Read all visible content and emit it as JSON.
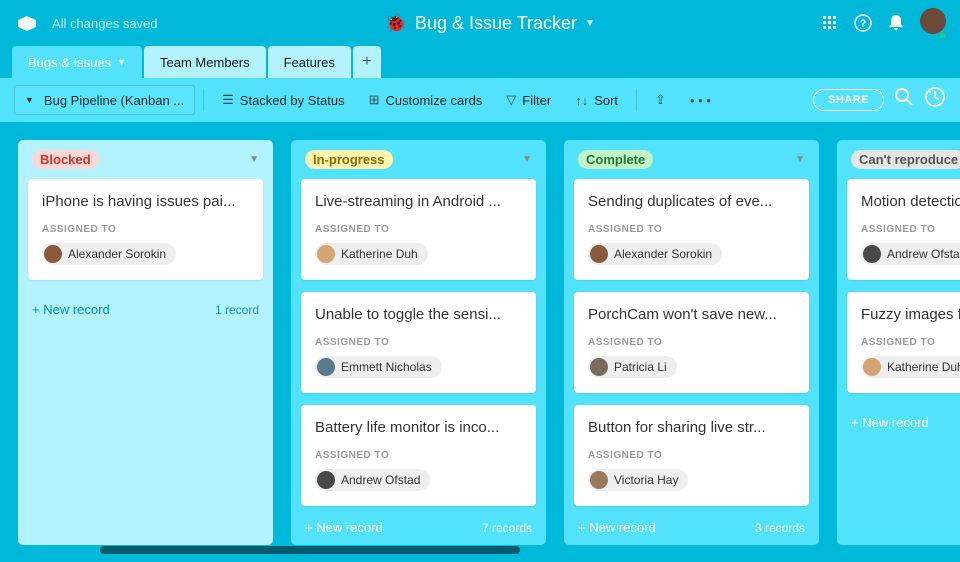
{
  "header": {
    "saved_status": "All changes saved",
    "title": "Bug & Issue Tracker"
  },
  "tabs": [
    {
      "label": "Bugs & Issues",
      "active": true,
      "has_caret": true
    },
    {
      "label": "Team Members",
      "active": false
    },
    {
      "label": "Features",
      "active": false
    }
  ],
  "toolbar": {
    "view_name": "Bug Pipeline (Kanban ...",
    "stacked": "Stacked by Status",
    "customize": "Customize cards",
    "filter": "Filter",
    "sort": "Sort",
    "share": "SHARE"
  },
  "columns": [
    {
      "title": "Blocked",
      "title_class": "title-blocked",
      "light": true,
      "record_count": "1 record",
      "new_record": "+ New record",
      "cards": [
        {
          "title": "iPhone is having issues pai...",
          "assigned_label": "ASSIGNED TO",
          "assignee": "Alexander Sorokin",
          "av": "c1"
        }
      ]
    },
    {
      "title": "In-progress",
      "title_class": "title-inprog",
      "light": false,
      "record_count": "7 records",
      "new_record": "+ New record",
      "cards": [
        {
          "title": "Live-streaming in Android ...",
          "assigned_label": "ASSIGNED TO",
          "assignee": "Katherine Duh",
          "av": "c2"
        },
        {
          "title": "Unable to toggle the sensi...",
          "assigned_label": "ASSIGNED TO",
          "assignee": "Emmett Nicholas",
          "av": "c3"
        },
        {
          "title": "Battery life monitor is inco...",
          "assigned_label": "ASSIGNED TO",
          "assignee": "Andrew Ofstad",
          "av": "c4"
        }
      ]
    },
    {
      "title": "Complete",
      "title_class": "title-complete",
      "light": false,
      "record_count": "3 records",
      "new_record": "+ New record",
      "cards": [
        {
          "title": "Sending duplicates of eve...",
          "assigned_label": "ASSIGNED TO",
          "assignee": "Alexander Sorokin",
          "av": "c1"
        },
        {
          "title": "PorchCam won't save new...",
          "assigned_label": "ASSIGNED TO",
          "assignee": "Patricia Li",
          "av": "c5"
        },
        {
          "title": "Button for sharing live str...",
          "assigned_label": "ASSIGNED TO",
          "assignee": "Victoria Hay",
          "av": "c6"
        }
      ]
    },
    {
      "title": "Can't reproduce",
      "title_class": "title-cantrep",
      "light": false,
      "record_count": "",
      "new_record": "+ New record",
      "cards": [
        {
          "title": "Motion detection",
          "assigned_label": "ASSIGNED TO",
          "assignee": "Andrew Ofstad",
          "av": "c4"
        },
        {
          "title": "Fuzzy images fro",
          "assigned_label": "ASSIGNED TO",
          "assignee": "Katherine Duh",
          "av": "c2"
        }
      ]
    }
  ]
}
